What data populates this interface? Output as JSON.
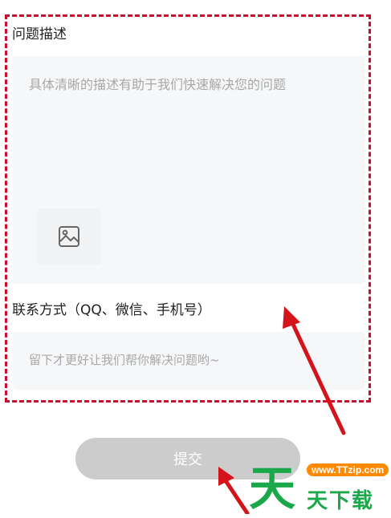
{
  "form": {
    "description_label": "问题描述",
    "description_placeholder": "具体清晰的描述有助于我们快速解决您的问题",
    "contact_label": "联系方式（QQ、微信、手机号）",
    "contact_placeholder": "留下才更好让我们帮你解决问题哟~",
    "submit_label": "提交"
  },
  "icons": {
    "image_upload": "image-icon"
  },
  "watermark": {
    "big_char": "天",
    "url": "www.TTzip.com",
    "text": "天下载"
  },
  "colors": {
    "highlight": "#c8102e",
    "field_bg": "#f6f7f9",
    "button_bg": "#cccccc",
    "watermark_green": "#1aa84a",
    "watermark_orange": "#ff8a00"
  }
}
